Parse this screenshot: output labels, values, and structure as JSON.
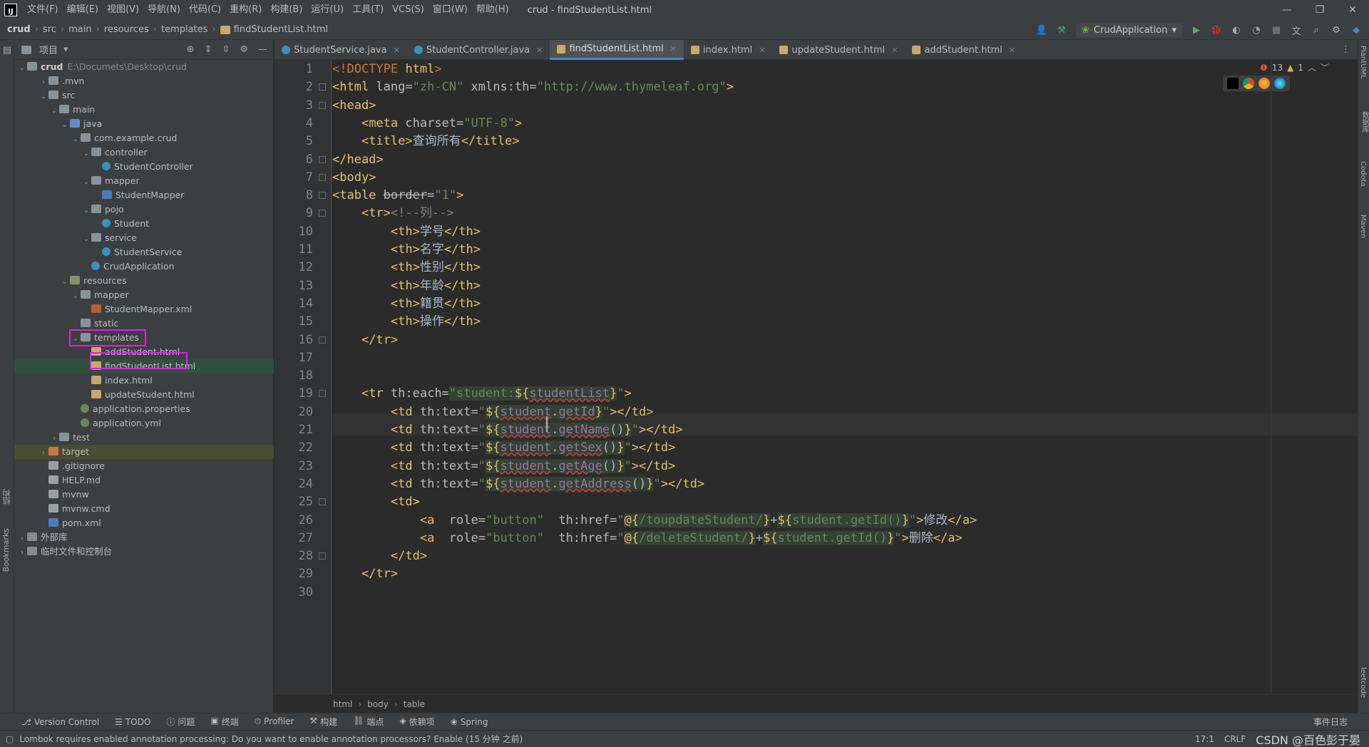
{
  "app": {
    "logo": "IJ",
    "title": "crud - findStudentList.html"
  },
  "menu": [
    "文件(F)",
    "编辑(E)",
    "视图(V)",
    "导航(N)",
    "代码(C)",
    "重构(R)",
    "构建(B)",
    "运行(U)",
    "工具(T)",
    "VCS(S)",
    "窗口(W)",
    "帮助(H)"
  ],
  "window_controls": [
    "—",
    "❐",
    "✕"
  ],
  "breadcrumb": [
    "crud",
    "src",
    "main",
    "resources",
    "templates",
    "findStudentList.html"
  ],
  "run_config": "CrudApplication",
  "project_panel": {
    "title": "项目",
    "root_name": "crud",
    "root_path": "E:\\Documets\\Desktop\\crud"
  },
  "tree": [
    {
      "label": ".mvn",
      "depth": 1,
      "arrow": "›",
      "icon": "folder"
    },
    {
      "label": "src",
      "depth": 1,
      "arrow": "⌄",
      "icon": "folder"
    },
    {
      "label": "main",
      "depth": 2,
      "arrow": "⌄",
      "icon": "folder"
    },
    {
      "label": "java",
      "depth": 3,
      "arrow": "⌄",
      "icon": "folder-src"
    },
    {
      "label": "com.example.crud",
      "depth": 4,
      "arrow": "⌄",
      "icon": "folder"
    },
    {
      "label": "controller",
      "depth": 5,
      "arrow": "⌄",
      "icon": "folder"
    },
    {
      "label": "StudentController",
      "depth": 6,
      "arrow": "",
      "icon": "cls"
    },
    {
      "label": "mapper",
      "depth": 5,
      "arrow": "⌄",
      "icon": "folder"
    },
    {
      "label": "StudentMapper",
      "depth": 6,
      "arrow": "",
      "icon": "mvn"
    },
    {
      "label": "pojo",
      "depth": 5,
      "arrow": "⌄",
      "icon": "folder"
    },
    {
      "label": "Student",
      "depth": 6,
      "arrow": "",
      "icon": "cls"
    },
    {
      "label": "service",
      "depth": 5,
      "arrow": "⌄",
      "icon": "folder"
    },
    {
      "label": "StudentService",
      "depth": 6,
      "arrow": "",
      "icon": "cls"
    },
    {
      "label": "CrudApplication",
      "depth": 5,
      "arrow": "",
      "icon": "cls"
    },
    {
      "label": "resources",
      "depth": 3,
      "arrow": "⌄",
      "icon": "folder-res"
    },
    {
      "label": "mapper",
      "depth": 4,
      "arrow": "⌄",
      "icon": "folder"
    },
    {
      "label": "StudentMapper.xml",
      "depth": 5,
      "arrow": "",
      "icon": "xml"
    },
    {
      "label": "static",
      "depth": 4,
      "arrow": "",
      "icon": "folder"
    },
    {
      "label": "templates",
      "depth": 4,
      "arrow": "⌄",
      "icon": "folder"
    },
    {
      "label": "addStudent.html",
      "depth": 5,
      "arrow": "",
      "icon": "html"
    },
    {
      "label": "findStudentList.html",
      "depth": 5,
      "arrow": "",
      "icon": "html",
      "selected": true
    },
    {
      "label": "index.html",
      "depth": 5,
      "arrow": "",
      "icon": "html"
    },
    {
      "label": "updateStudent.html",
      "depth": 5,
      "arrow": "",
      "icon": "html"
    },
    {
      "label": "application.properties",
      "depth": 4,
      "arrow": "",
      "icon": "prop"
    },
    {
      "label": "application.yml",
      "depth": 4,
      "arrow": "",
      "icon": "prop"
    },
    {
      "label": "test",
      "depth": 2,
      "arrow": "›",
      "icon": "folder"
    },
    {
      "label": "target",
      "depth": 1,
      "arrow": "›",
      "icon": "folder-target",
      "highlight": true
    },
    {
      "label": ".gitignore",
      "depth": 1,
      "arrow": "",
      "icon": "file"
    },
    {
      "label": "HELP.md",
      "depth": 1,
      "arrow": "",
      "icon": "file"
    },
    {
      "label": "mvnw",
      "depth": 1,
      "arrow": "",
      "icon": "file"
    },
    {
      "label": "mvnw.cmd",
      "depth": 1,
      "arrow": "",
      "icon": "file"
    },
    {
      "label": "pom.xml",
      "depth": 1,
      "arrow": "",
      "icon": "mvn"
    },
    {
      "label": "外部库",
      "depth": 0,
      "arrow": "›",
      "icon": "lib"
    },
    {
      "label": "临时文件和控制台",
      "depth": 0,
      "arrow": "›",
      "icon": "lib"
    }
  ],
  "tabs": [
    {
      "label": "StudentService.java",
      "icon": "c",
      "active": false
    },
    {
      "label": "StudentController.java",
      "icon": "c",
      "active": false
    },
    {
      "label": "findStudentList.html",
      "icon": "h",
      "active": true
    },
    {
      "label": "index.html",
      "icon": "h",
      "active": false
    },
    {
      "label": "updateStudent.html",
      "icon": "h",
      "active": false
    },
    {
      "label": "addStudent.html",
      "icon": "h",
      "active": false
    }
  ],
  "inspection": {
    "errors": "13",
    "warnings": "1"
  },
  "code_lines": [
    [
      [
        "t-el",
        "<!DOCTYPE "
      ],
      [
        "t-tag",
        "html"
      ],
      [
        "t-el",
        ">"
      ]
    ],
    [
      [
        "t-tag",
        "<html "
      ],
      [
        "t-attr",
        "lang="
      ],
      [
        "t-str",
        "\"zh-CN\" "
      ],
      [
        "t-attr",
        "xmlns:th="
      ],
      [
        "t-str",
        "\"http://www.thymeleaf.org\""
      ],
      [
        "t-tag",
        ">"
      ]
    ],
    [
      [
        "t-tag",
        "<head>"
      ]
    ],
    [
      [
        "t-txt",
        "    "
      ],
      [
        "t-tag",
        "<meta "
      ],
      [
        "t-attr",
        "charset="
      ],
      [
        "t-str",
        "\"UTF-8\""
      ],
      [
        "t-tag",
        ">"
      ]
    ],
    [
      [
        "t-txt",
        "    "
      ],
      [
        "t-tag",
        "<title>"
      ],
      [
        "t-txt",
        "查询所有"
      ],
      [
        "t-tag",
        "</title>"
      ]
    ],
    [
      [
        "t-tag",
        "</head>"
      ]
    ],
    [
      [
        "t-tag",
        "<body>"
      ]
    ],
    [
      [
        "t-tag",
        "<table "
      ],
      [
        "t-attr t-strike",
        "border"
      ],
      [
        "t-attr",
        "="
      ],
      [
        "t-str",
        "\"1\""
      ],
      [
        "t-tag",
        ">"
      ]
    ],
    [
      [
        "t-txt",
        "    "
      ],
      [
        "t-tag",
        "<tr>"
      ],
      [
        "t-com",
        "<!--列-->"
      ]
    ],
    [
      [
        "t-txt",
        "        "
      ],
      [
        "t-tag",
        "<th>"
      ],
      [
        "t-txt",
        "学号"
      ],
      [
        "t-tag",
        "</th>"
      ]
    ],
    [
      [
        "t-txt",
        "        "
      ],
      [
        "t-tag",
        "<th>"
      ],
      [
        "t-txt",
        "名字"
      ],
      [
        "t-tag",
        "</th>"
      ]
    ],
    [
      [
        "t-txt",
        "        "
      ],
      [
        "t-tag",
        "<th>"
      ],
      [
        "t-txt",
        "性别"
      ],
      [
        "t-tag",
        "</th>"
      ]
    ],
    [
      [
        "t-txt",
        "        "
      ],
      [
        "t-tag",
        "<th>"
      ],
      [
        "t-txt",
        "年龄"
      ],
      [
        "t-tag",
        "</th>"
      ]
    ],
    [
      [
        "t-txt",
        "        "
      ],
      [
        "t-tag",
        "<th>"
      ],
      [
        "t-txt",
        "籍贯"
      ],
      [
        "t-tag",
        "</th>"
      ]
    ],
    [
      [
        "t-txt",
        "        "
      ],
      [
        "t-tag",
        "<th>"
      ],
      [
        "t-txt",
        "操作"
      ],
      [
        "t-tag",
        "</th>"
      ]
    ],
    [
      [
        "t-txt",
        "    "
      ],
      [
        "t-tag",
        "</tr>"
      ]
    ],
    [
      [
        "t-txt",
        ""
      ]
    ],
    [
      [
        "t-txt",
        ""
      ]
    ],
    [
      [
        "t-txt",
        "    "
      ],
      [
        "t-tag",
        "<tr "
      ],
      [
        "t-thattr",
        "th:each="
      ],
      [
        "t-str hl-bg",
        "\"student:"
      ],
      [
        "t-tag hl-bg",
        "${"
      ],
      [
        "t-expr t-err hl-bg",
        "studentList"
      ],
      [
        "t-tag hl-bg",
        "}"
      ],
      [
        "t-str",
        "\""
      ],
      [
        "t-tag",
        ">"
      ]
    ],
    [
      [
        "t-txt",
        "        "
      ],
      [
        "t-tag",
        "<td "
      ],
      [
        "t-thattr",
        "th:text="
      ],
      [
        "t-str",
        "\""
      ],
      [
        "t-tag hl-bg",
        "${"
      ],
      [
        "t-expr t-err hl-bg",
        "student"
      ],
      [
        "t-txt hl-bg",
        "."
      ],
      [
        "t-expr t-err hl-bg",
        "getId"
      ],
      [
        "t-tag hl-bg",
        "}"
      ],
      [
        "t-str",
        "\""
      ],
      [
        "t-tag",
        "></td>"
      ]
    ],
    [
      [
        "t-txt",
        "        "
      ],
      [
        "t-tag",
        "<td "
      ],
      [
        "t-thattr",
        "th:text="
      ],
      [
        "t-str",
        "\""
      ],
      [
        "t-tag hl-bg",
        "${"
      ],
      [
        "t-expr t-err hl-bg",
        "student"
      ],
      [
        "t-txt hl-bg",
        "."
      ],
      [
        "t-expr t-err hl-bg",
        "getName"
      ],
      [
        "t-txt hl-bg",
        "()"
      ],
      [
        "t-tag hl-bg",
        "}"
      ],
      [
        "t-str",
        "\""
      ],
      [
        "t-tag",
        "></td>"
      ]
    ],
    [
      [
        "t-txt",
        "        "
      ],
      [
        "t-tag",
        "<td "
      ],
      [
        "t-thattr",
        "th:text="
      ],
      [
        "t-str",
        "\""
      ],
      [
        "t-tag hl-bg",
        "${"
      ],
      [
        "t-expr t-err hl-bg",
        "student"
      ],
      [
        "t-txt hl-bg",
        "."
      ],
      [
        "t-expr t-err hl-bg",
        "getSex"
      ],
      [
        "t-txt hl-bg",
        "()"
      ],
      [
        "t-tag hl-bg",
        "}"
      ],
      [
        "t-str",
        "\""
      ],
      [
        "t-tag",
        "></td>"
      ]
    ],
    [
      [
        "t-txt",
        "        "
      ],
      [
        "t-tag",
        "<td "
      ],
      [
        "t-thattr",
        "th:text="
      ],
      [
        "t-str",
        "\""
      ],
      [
        "t-tag hl-bg",
        "${"
      ],
      [
        "t-expr t-err hl-bg",
        "student"
      ],
      [
        "t-txt hl-bg",
        "."
      ],
      [
        "t-expr t-err hl-bg",
        "getAge"
      ],
      [
        "t-txt hl-bg",
        "()"
      ],
      [
        "t-tag hl-bg",
        "}"
      ],
      [
        "t-str",
        "\""
      ],
      [
        "t-tag",
        "></td>"
      ]
    ],
    [
      [
        "t-txt",
        "        "
      ],
      [
        "t-tag",
        "<td "
      ],
      [
        "t-thattr",
        "th:text="
      ],
      [
        "t-str",
        "\""
      ],
      [
        "t-tag hl-bg",
        "${"
      ],
      [
        "t-expr t-err hl-bg",
        "student"
      ],
      [
        "t-txt hl-bg",
        "."
      ],
      [
        "t-expr t-err hl-bg",
        "getAddress"
      ],
      [
        "t-txt hl-bg",
        "()"
      ],
      [
        "t-tag hl-bg",
        "}"
      ],
      [
        "t-str",
        "\""
      ],
      [
        "t-tag",
        "></td>"
      ]
    ],
    [
      [
        "t-txt",
        "        "
      ],
      [
        "t-tag",
        "<td>"
      ]
    ],
    [
      [
        "t-txt",
        "            "
      ],
      [
        "t-tag",
        "<a  "
      ],
      [
        "t-attr",
        "role="
      ],
      [
        "t-str",
        "\"button\"  "
      ],
      [
        "t-thattr",
        "th:href="
      ],
      [
        "t-str",
        "\""
      ],
      [
        "t-tag hl-bg",
        "@{"
      ],
      [
        "t-str hl-bg",
        "/toupdateStudent/"
      ],
      [
        "t-tag hl-bg",
        "}"
      ],
      [
        "t-txt",
        "+"
      ],
      [
        "t-tag hl-bg",
        "${"
      ],
      [
        "t-str hl-bg",
        "student.getId()"
      ],
      [
        "t-tag hl-bg",
        "}"
      ],
      [
        "t-str",
        "\""
      ],
      [
        "t-tag",
        ">"
      ],
      [
        "t-txt",
        "修改"
      ],
      [
        "t-tag",
        "</a>"
      ]
    ],
    [
      [
        "t-txt",
        "            "
      ],
      [
        "t-tag",
        "<a  "
      ],
      [
        "t-attr",
        "role="
      ],
      [
        "t-str",
        "\"button\"  "
      ],
      [
        "t-thattr",
        "th:href="
      ],
      [
        "t-str",
        "\""
      ],
      [
        "t-tag hl-bg",
        "@{"
      ],
      [
        "t-str hl-bg",
        "/deleteStudent/"
      ],
      [
        "t-tag hl-bg",
        "}"
      ],
      [
        "t-txt",
        "+"
      ],
      [
        "t-tag hl-bg",
        "${"
      ],
      [
        "t-str hl-bg",
        "student.getId()"
      ],
      [
        "t-tag hl-bg",
        "}"
      ],
      [
        "t-str",
        "\""
      ],
      [
        "t-tag",
        ">"
      ],
      [
        "t-txt",
        "删除"
      ],
      [
        "t-tag",
        "</a>"
      ]
    ],
    [
      [
        "t-txt",
        "        "
      ],
      [
        "t-tag",
        "</td>"
      ]
    ],
    [
      [
        "t-txt",
        "    "
      ],
      [
        "t-tag",
        "</tr>"
      ]
    ]
  ],
  "editor_breadcrumb": [
    "html",
    "body",
    "table"
  ],
  "left_stripe_labels": [
    "结构",
    "Bookmarks"
  ],
  "right_stripe_labels": [
    "PlantUML",
    "数据库",
    "Codota",
    "Maven",
    "leetcode"
  ],
  "bottom_tools": [
    "Version Control",
    "TODO",
    "问题",
    "终端",
    "Profiler",
    "构建",
    "端点",
    "依赖项",
    "Spring"
  ],
  "event_log": "事件日志",
  "status_message": "Lombok requires enabled annotation processing: Do you want to enable annotation processors? Enable (15 分钟 之前)",
  "cursor_position": "17:1",
  "line_sep": "CRLF",
  "watermark": "CSDN @百色彭于晏"
}
